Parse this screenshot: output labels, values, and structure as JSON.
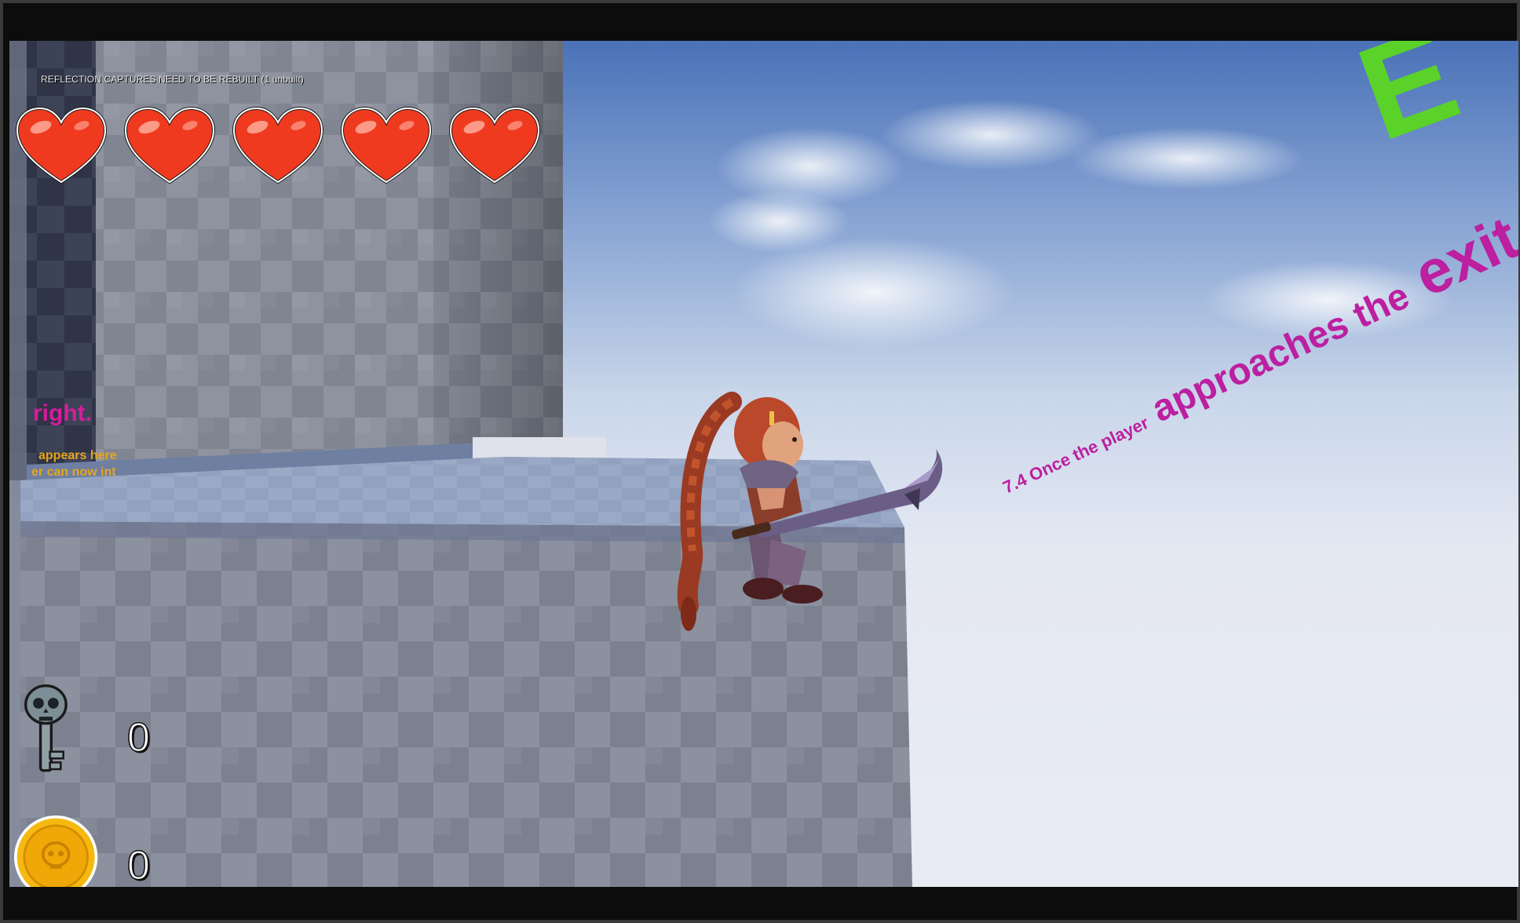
{
  "debug": {
    "message": "REFLECTION CAPTURES NEED TO BE REBUILT (1 unbuilt)",
    "sub_message": ""
  },
  "hud": {
    "health": {
      "hearts_full": 5,
      "hearts_total": 5,
      "icon": "heart-icon"
    },
    "keys": {
      "icon": "skull-key-icon",
      "count": "0"
    },
    "coins": {
      "icon": "skull-coin-icon",
      "count": "0"
    }
  },
  "world_text": {
    "wall_heading": "right.",
    "wall_line_1": "appears here",
    "wall_line_2": "er can now int",
    "wall_faint": "",
    "diagonal_part_1": "7.4 Once the player",
    "diagonal_part_2": " approaches the",
    "diagonal_part_3": " exit the",
    "green_sign": "E"
  },
  "colors": {
    "heart_red": "#f03a1f",
    "magenta_text": "#bc1fa0",
    "orange_text": "#e6a51d",
    "green_text": "#5bd229",
    "coin_gold": "#f5b90f",
    "sky_top": "#4a72b8",
    "sky_bottom": "#e9ebf4"
  }
}
